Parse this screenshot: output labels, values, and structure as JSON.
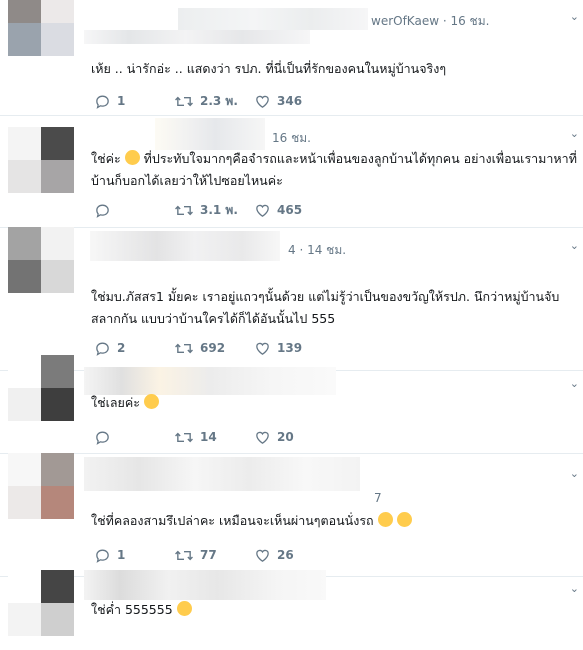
{
  "colors": {
    "text": "#14171a",
    "muted": "#657786",
    "divider": "#e6ecf0",
    "emoji": "#ffcc4d"
  },
  "tweets": [
    {
      "handle_fragment": "werOfKaew",
      "time": "· 16 ชม.",
      "text": "เห้ย .. น่ารักอ่ะ .. แสดงว่า รปภ. ที่นี่เป็นที่รักของคนในหมู่บ้านจริงๆ",
      "replies": "1",
      "retweets": "2.3 พ.",
      "likes": "346"
    },
    {
      "handle_fragment": "",
      "time": "16 ชม.",
      "text_before_emoji": "ใช่ค่ะ",
      "text_after_emoji": "ที่ประทับใจมากๆคือจำรถและหน้าเพื่อนของลูกบ้านได้ทุกคน อย่างเพื่อนเรามาหาที่บ้านก็บอกได้เลยว่าให้ไปซอยไหนค่ะ",
      "emoji": "face-with-rolling-eyes-emoji",
      "replies": "",
      "retweets": "3.1 พ.",
      "likes": "465"
    },
    {
      "handle_fragment": "4",
      "time": "· 14 ชม.",
      "text": "ใช่มบ.ภัสสร1 มั้ยคะ เราอยู่แถวๆนั้นด้วย แต่ไม่รู้ว่าเป็นของขวัญให้รปภ. นึกว่าหมู่บ้านจับสลากกัน แบบว่าบ้านใครได้ก็ได้อันนั้นไป 555",
      "replies": "2",
      "retweets": "692",
      "likes": "139"
    },
    {
      "handle_fragment": "",
      "time": "",
      "text": "ใช่เลยค่ะ",
      "emoji": "tears-of-joy-emoji",
      "replies": "",
      "retweets": "14",
      "likes": "20"
    },
    {
      "handle_fragment": "7",
      "time": "",
      "text": "ใช่ที่คลองสามรึเปล่าคะ เหมือนจะเห็นผ่านๆตอนนั่งรถ",
      "emoji": "tears-of-joy-emoji",
      "replies": "1",
      "retweets": "77",
      "likes": "26"
    },
    {
      "handle_fragment": "",
      "time": "",
      "text": "ใช่ค่ำ 555555",
      "emoji": "grinning-squinting-emoji",
      "replies": "",
      "retweets": "",
      "likes": ""
    }
  ]
}
